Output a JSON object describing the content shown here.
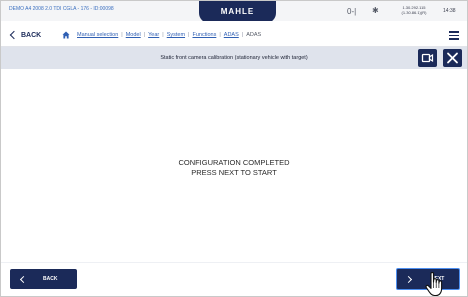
{
  "status_bar": {
    "vehicle": "DEMO A4 2008 2.0 TDI CGLA - 176 - ID:00098",
    "logo": "MAHLE",
    "vci_label": "0-|",
    "version_line1": "1.30.292.115",
    "version_line2": "(1.30.86.1)(R)",
    "time": "14:38"
  },
  "nav": {
    "back_label": "BACK",
    "breadcrumbs": [
      "Manual selection",
      "Model",
      "Year",
      "System",
      "Functions",
      "ADAS"
    ],
    "current": "ADAS"
  },
  "title_bar": {
    "title": "Static front camera calibration (stationary vehicle with target)"
  },
  "main": {
    "line1": "CONFIGURATION COMPLETED",
    "line2": "PRESS NEXT TO START"
  },
  "footer": {
    "back_label": "BACK",
    "next_label": "NEXT"
  },
  "icons": {
    "home": "home-icon",
    "bluetooth": "bluetooth-icon",
    "vci": "vci-connection-icon",
    "menu": "hamburger-menu-icon",
    "camera": "camera-icon",
    "close": "close-icon",
    "cursor": "hand-pointer-icon"
  },
  "colors": {
    "brand_navy": "#1b2a59",
    "link_blue": "#2f5fb3",
    "title_bar_bg": "#dfe3ec",
    "next_highlight": "#4d8ff0"
  }
}
